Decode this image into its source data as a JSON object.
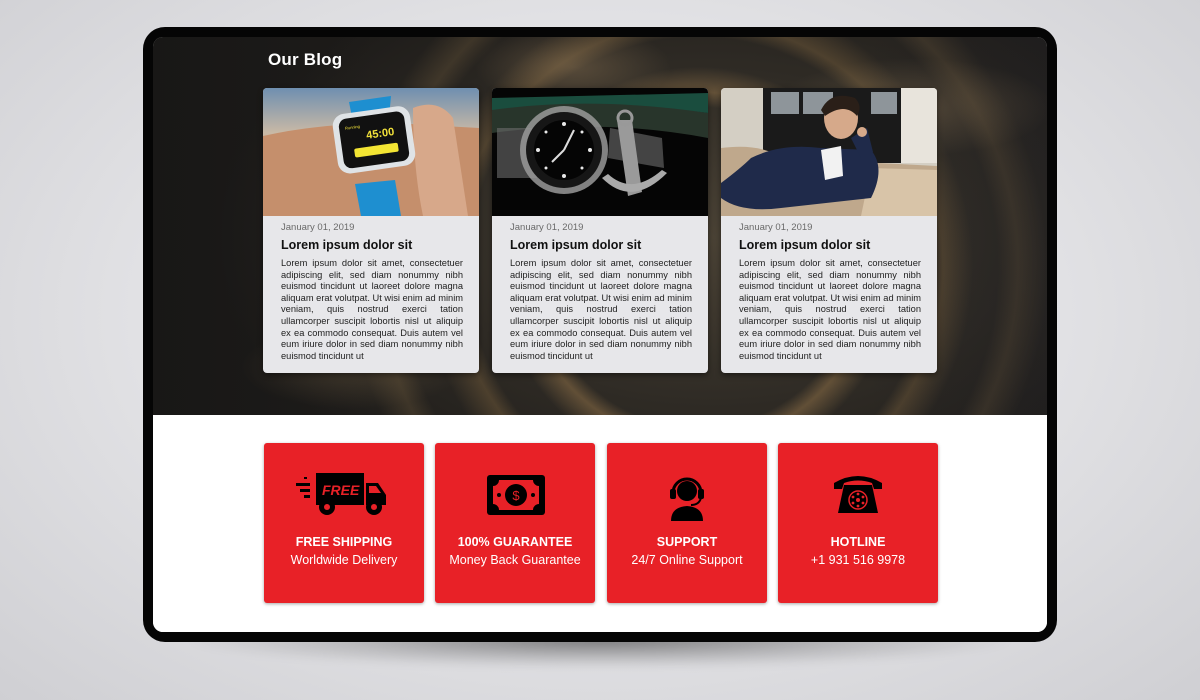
{
  "blog": {
    "heading": "Our Blog",
    "posts": [
      {
        "image": "smartwatch-on-wrist-photo",
        "date": "January 01, 2019",
        "title": "Lorem ipsum dolor sit",
        "excerpt": "Lorem ipsum dolor sit amet, consectetuer adipiscing elit, sed diam nonummy nibh euismod tincidunt ut laoreet dolore magna aliquam erat volutpat. Ut wisi enim ad minim veniam, quis nostrud exerci tation ullamcorper suscipit lobortis nisl ut aliquip ex ea commodo consequat. Duis autem vel eum iriure dolor in sed diam nonummy nibh euismod tincidunt ut"
      },
      {
        "image": "dive-watch-with-anchor-photo",
        "date": "January 01, 2019",
        "title": "Lorem ipsum dolor sit",
        "excerpt": "Lorem ipsum dolor sit amet, consectetuer adipiscing elit, sed diam nonummy nibh euismod tincidunt ut laoreet dolore magna aliquam erat volutpat. Ut wisi enim ad minim veniam, quis nostrud exerci tation ullamcorper suscipit lobortis nisl ut aliquip ex ea commodo consequat. Duis autem vel eum iriure dolor in sed diam nonummy nibh euismod tincidunt ut"
      },
      {
        "image": "man-in-suit-on-sofa-photo",
        "date": "January 01, 2019",
        "title": "Lorem ipsum dolor sit",
        "excerpt": "Lorem ipsum dolor sit amet, consectetuer adipiscing elit, sed diam nonummy nibh euismod tincidunt ut laoreet dolore magna aliquam erat volutpat. Ut wisi enim ad minim veniam, quis nostrud exerci tation ullamcorper suscipit lobortis nisl ut aliquip ex ea commodo consequat. Duis autem vel eum iriure dolor in sed diam nonummy nibh euismod tincidunt ut"
      }
    ],
    "watch_screen": {
      "label": "Running",
      "time": "45:00"
    }
  },
  "features": [
    {
      "icon": "delivery-truck-icon",
      "icon_text": "FREE",
      "title": "FREE SHIPPING",
      "subtitle": "Worldwide Delivery"
    },
    {
      "icon": "dollar-bill-icon",
      "icon_text": "$",
      "title": "100% GUARANTEE",
      "subtitle": "Money Back Guarantee"
    },
    {
      "icon": "headset-support-icon",
      "title": "SUPPORT",
      "subtitle": "24/7 Online Support"
    },
    {
      "icon": "rotary-phone-icon",
      "title": "HOTLINE",
      "subtitle": "+1 931 516 9978"
    }
  ],
  "colors": {
    "accent_red": "#e82127",
    "card_bg": "#e7e7ea",
    "device_frame": "#050505"
  }
}
